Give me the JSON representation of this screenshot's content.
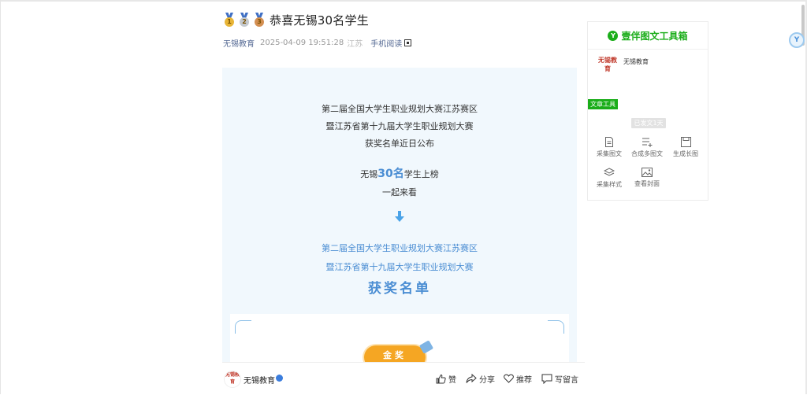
{
  "article": {
    "title": "恭喜无锡30名学生",
    "medals": [
      {
        "icon": "gold-medal-icon",
        "color": "#e8b537",
        "num": "1"
      },
      {
        "icon": "silver-medal-icon",
        "color": "#c4c9cf",
        "num": "2"
      },
      {
        "icon": "bronze-medal-icon",
        "color": "#d38f52",
        "num": "3"
      }
    ],
    "author": "无锡教育",
    "datetime": "2025-04-09 19:51:28",
    "region": "江苏",
    "mobile_read": "手机阅读"
  },
  "content": {
    "intro_line1": "第二届全国大学生职业规划大赛江苏赛区",
    "intro_line2": "暨江苏省第十九届大学生职业规划大赛",
    "intro_line3": "获奖名单近日公布",
    "highlight_pre": "无锡",
    "highlight_num": "30名",
    "highlight_post": "学生上榜",
    "together": "一起来看",
    "sub_line1": "第二届全国大学生职业规划大赛江苏赛区",
    "sub_line2": "暨江苏省第十九届大学生职业规划大赛",
    "list_title": "获奖名单",
    "gold_award": "金奖"
  },
  "bottom_bar": {
    "account_name": "无锡教育",
    "avatar_text": "无锡教育",
    "like": "赞",
    "share": "分享",
    "favorite": "推荐",
    "comment": "写留言"
  },
  "toolbox": {
    "title": "壹伴图文工具箱",
    "logo_char": "Y",
    "account": "无锡教育",
    "avatar_text": "无锡教育",
    "tag": "文章工具",
    "days_pill": "已发文1天",
    "tools": [
      {
        "label": "采集图文",
        "icon": "document-icon"
      },
      {
        "label": "合成多图文",
        "icon": "merge-list-icon"
      },
      {
        "label": "生成长图",
        "icon": "save-image-icon"
      },
      {
        "label": "采集样式",
        "icon": "layers-icon"
      },
      {
        "label": "查看封面",
        "icon": "image-icon"
      }
    ]
  },
  "float_button": {
    "label": "Y"
  },
  "colors": {
    "accent_blue": "#4a8dd3",
    "brand_green": "#1aad19",
    "gold": "#f5a623",
    "panel_bg": "#f1f8fd"
  }
}
